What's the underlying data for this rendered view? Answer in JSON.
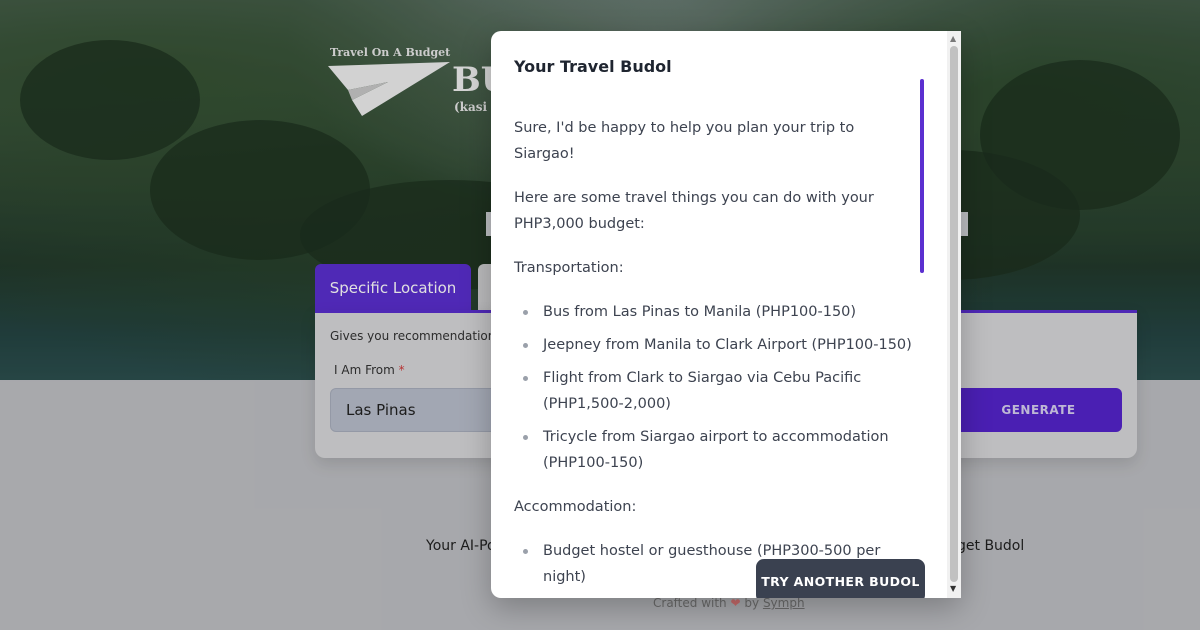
{
  "hero": {
    "logo_tagline": "Travel On A Budget",
    "logo_word": "BU",
    "logo_sub": "(kasi w"
  },
  "tabs": {
    "active_label": "Specific Location",
    "inactive_label": ""
  },
  "form": {
    "description": "Gives you recommendations",
    "from_label": "I Am From",
    "required_mark": "*",
    "from_value": "Las Pinas",
    "generate_label": "GENERATE"
  },
  "page_text": {
    "bottom_left": "Your AI-Po",
    "bottom_right": "get Budol",
    "footer_prefix": "Crafted with",
    "footer_by": "by",
    "footer_link": "Symph"
  },
  "modal": {
    "title": "Your Travel Budol",
    "intro": "Sure, I'd be happy to help you plan your trip to Siargao!",
    "budget_line": "Here are some travel things you can do with your PHP3,000 budget:",
    "transport_heading": "Transportation:",
    "transport_items": [
      "Bus from Las Pinas to Manila (PHP100-150)",
      "Jeepney from Manila to Clark Airport (PHP100-150)",
      "Flight from Clark to Siargao via Cebu Pacific (PHP1,500-2,000)",
      "Tricycle from Siargao airport to accommodation (PHP100-150)"
    ],
    "accommodation_heading": "Accommodation:",
    "accommodation_items": [
      "Budget hostel or guesthouse (PHP300-500 per night)"
    ],
    "try_again_label": "TRY ANOTHER BUDOL"
  },
  "colors": {
    "accent": "#5b2fd0",
    "button_dark": "#3a4150"
  },
  "icons": {
    "logo": "paper-plane-icon",
    "heart": "heart-icon",
    "scroll_up": "arrow-up-icon",
    "scroll_down": "arrow-down-icon"
  }
}
